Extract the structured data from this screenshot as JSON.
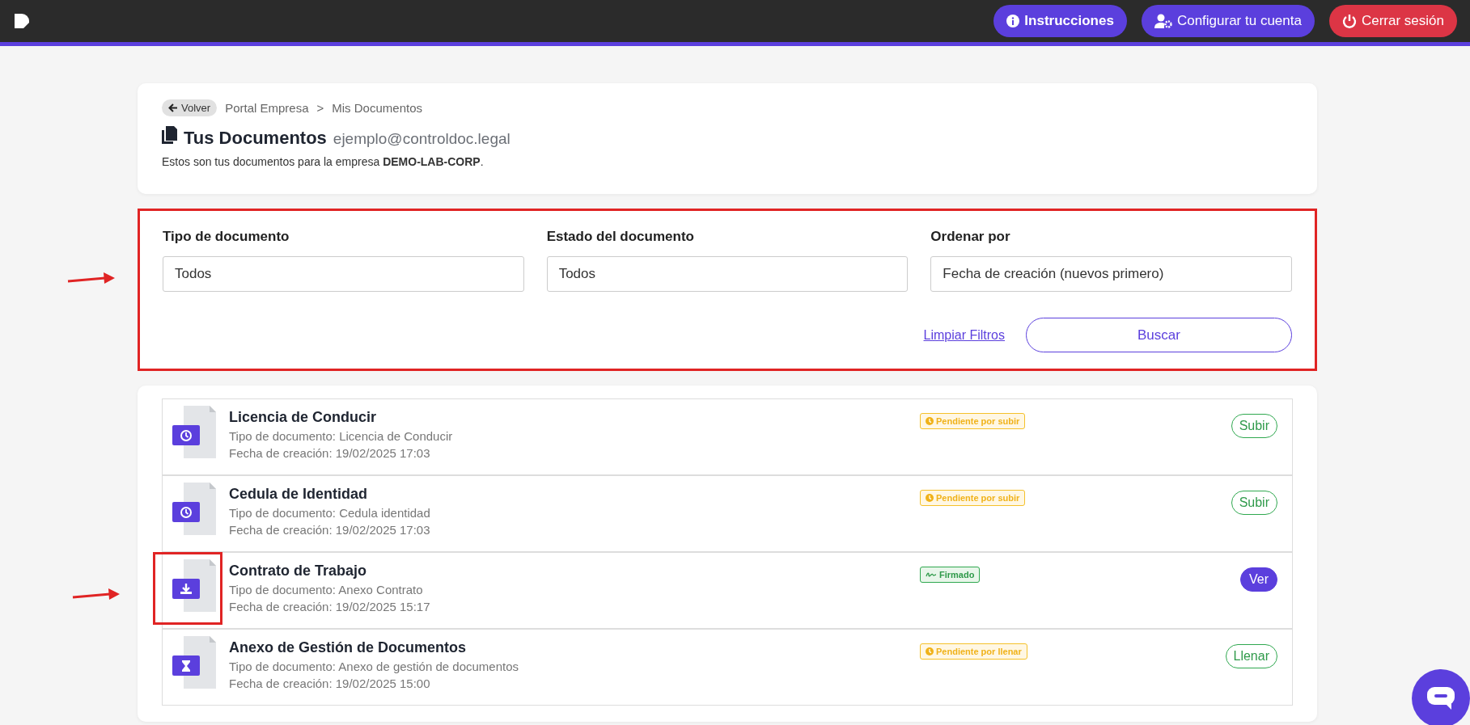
{
  "header": {
    "buttons": [
      {
        "label": "Instrucciones",
        "kind": "info"
      },
      {
        "label": "Configurar tu cuenta",
        "kind": "account"
      },
      {
        "label": "Cerrar sesión",
        "kind": "logout"
      }
    ]
  },
  "intro": {
    "back": "Volver",
    "breadcrumb": [
      "Portal Empresa",
      "Mis Documentos"
    ],
    "separator": ">",
    "title": "Tus Documentos",
    "email": "ejemplo@controldoc.legal",
    "description": "Estos son tus documentos para la empresa **DEMO-LAB-CORP**."
  },
  "filters": {
    "fields": [
      {
        "label": "Tipo de documento",
        "value": "Todos"
      },
      {
        "label": "Estado del documento",
        "value": "Todos"
      },
      {
        "label": "Ordenar por",
        "value": "Fecha de creación (nuevos primero)"
      }
    ],
    "clear": "Limpiar Filtros",
    "search": "Buscar"
  },
  "documents": [
    {
      "title": "Licencia de Conducir",
      "type": "Tipo de documento: Licencia de Conducir",
      "date": "Fecha de creación: 19/02/2025 17:03",
      "kind": "clock",
      "status": {
        "label": "Pendiente por subir",
        "kind": "pending"
      },
      "action": {
        "label": "Subir",
        "kind": "outline"
      },
      "highlighted": false
    },
    {
      "title": "Cedula de Identidad",
      "type": "Tipo de documento: Cedula identidad",
      "date": "Fecha de creación: 19/02/2025 17:03",
      "kind": "clock",
      "status": {
        "label": "Pendiente por subir",
        "kind": "pending"
      },
      "action": {
        "label": "Subir",
        "kind": "outline"
      },
      "highlighted": false
    },
    {
      "title": "Contrato de Trabajo",
      "type": "Tipo de documento: Anexo Contrato",
      "date": "Fecha de creación: 19/02/2025 15:17",
      "kind": "download",
      "status": {
        "label": "Firmado",
        "kind": "signed"
      },
      "action": {
        "label": "Ver",
        "kind": "filled"
      },
      "highlighted": true
    },
    {
      "title": "Anexo de Gestión de Documentos",
      "type": "Tipo de documento: Anexo de gestión de documentos",
      "date": "Fecha de creación: 19/02/2025 15:00",
      "kind": "hourglass",
      "status": {
        "label": "Pendiente por llenar",
        "kind": "pending"
      },
      "action": {
        "label": "Llenar",
        "kind": "outline"
      },
      "highlighted": false
    }
  ]
}
